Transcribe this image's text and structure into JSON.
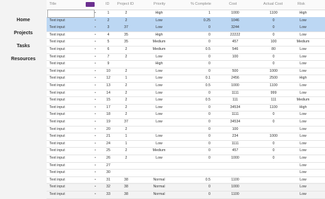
{
  "nav": [
    "Home",
    "Projects",
    "Tasks",
    "Resources"
  ],
  "columns": {
    "title": "Title",
    "id": "ID",
    "project_id": "Project ID",
    "priority": "Priority",
    "percent_complete": "% Complete",
    "cost": "Cost",
    "actual_cost": "Actual Cost",
    "risk": "Risk"
  },
  "selected_row": 0,
  "highlight_rows": [
    1,
    2
  ],
  "rows": [
    {
      "title": "Text input",
      "id": "1",
      "pid": "2",
      "pri": "High",
      "pct": "1",
      "cost": "1000",
      "act": "1100",
      "risk": "High"
    },
    {
      "title": "Text input",
      "id": "2",
      "pid": "2",
      "pri": "Low",
      "pct": "0.25",
      "cost": "1046",
      "act": "0",
      "risk": "Low"
    },
    {
      "title": "Text input",
      "id": "3",
      "pid": "37",
      "pri": "Low",
      "pct": "0",
      "cost": "3244",
      "act": "0",
      "risk": "Low"
    },
    {
      "title": "Text input",
      "id": "4",
      "pid": "35",
      "pri": "High",
      "pct": "0",
      "cost": "22222",
      "act": "0",
      "risk": "Low"
    },
    {
      "title": "Text input",
      "id": "5",
      "pid": "35",
      "pri": "Medium",
      "pct": "0",
      "cost": "457",
      "act": "100",
      "risk": "Medium"
    },
    {
      "title": "Text input",
      "id": "6",
      "pid": "2",
      "pri": "Medium",
      "pct": "0.5",
      "cost": "546",
      "act": "80",
      "risk": "Low"
    },
    {
      "title": "Text input",
      "id": "7",
      "pid": "2",
      "pri": "Low",
      "pct": "0",
      "cost": "100",
      "act": "0",
      "risk": "Low"
    },
    {
      "title": "Text input",
      "id": "9",
      "pid": "",
      "pri": "High",
      "pct": "0",
      "cost": "",
      "act": "0",
      "risk": "Low"
    },
    {
      "title": "Text input",
      "id": "10",
      "pid": "2",
      "pri": "Low",
      "pct": "0",
      "cost": "500",
      "act": "1000",
      "risk": "Low"
    },
    {
      "title": "Text input",
      "id": "12",
      "pid": "1",
      "pri": "Low",
      "pct": "0.1",
      "cost": "2456",
      "act": "2500",
      "risk": "High"
    },
    {
      "title": "Text input",
      "id": "13",
      "pid": "2",
      "pri": "Low",
      "pct": "0.5",
      "cost": "1000",
      "act": "1100",
      "risk": "Low"
    },
    {
      "title": "Text input",
      "id": "14",
      "pid": "2",
      "pri": "Low",
      "pct": "0",
      "cost": "1111",
      "act": "999",
      "risk": "Low"
    },
    {
      "title": "Text input",
      "id": "15",
      "pid": "2",
      "pri": "Low",
      "pct": "0.5",
      "cost": "111",
      "act": "111",
      "risk": "Medium"
    },
    {
      "title": "Text input",
      "id": "17",
      "pid": "2",
      "pri": "Low",
      "pct": "0",
      "cost": "34534",
      "act": "1100",
      "risk": "High"
    },
    {
      "title": "Text input",
      "id": "18",
      "pid": "2",
      "pri": "Low",
      "pct": "0",
      "cost": "1111",
      "act": "0",
      "risk": "Low"
    },
    {
      "title": "Text input",
      "id": "19",
      "pid": "37",
      "pri": "Low",
      "pct": "0",
      "cost": "34534",
      "act": "0",
      "risk": "Low"
    },
    {
      "title": "Text input",
      "id": "20",
      "pid": "2",
      "pri": "",
      "pct": "0",
      "cost": "100",
      "act": "",
      "risk": "Low"
    },
    {
      "title": "Text input",
      "id": "21",
      "pid": "1",
      "pri": "Low",
      "pct": "0",
      "cost": "234",
      "act": "1000",
      "risk": "Low"
    },
    {
      "title": "Text input",
      "id": "24",
      "pid": "1",
      "pri": "Low",
      "pct": "0",
      "cost": "1111",
      "act": "0",
      "risk": "Low"
    },
    {
      "title": "Text input",
      "id": "25",
      "pid": "2",
      "pri": "Medium",
      "pct": "0",
      "cost": "457",
      "act": "0",
      "risk": "Low"
    },
    {
      "title": "Text input",
      "id": "26",
      "pid": "2",
      "pri": "Low",
      "pct": "0",
      "cost": "1000",
      "act": "0",
      "risk": "Low"
    },
    {
      "title": "Text input",
      "id": "27",
      "pid": "",
      "pri": "",
      "pct": "",
      "cost": "",
      "act": "",
      "risk": "Low"
    },
    {
      "title": "Text input",
      "id": "30",
      "pid": "",
      "pri": "",
      "pct": "",
      "cost": "",
      "act": "",
      "risk": "Low"
    },
    {
      "title": "Text input",
      "id": "31",
      "pid": "38",
      "pri": "Normal",
      "pct": "0.5",
      "cost": "1100",
      "act": "",
      "risk": "Low"
    },
    {
      "title": "Text input",
      "id": "32",
      "pid": "38",
      "pri": "Normal",
      "pct": "0",
      "cost": "1000",
      "act": "",
      "risk": "Low"
    },
    {
      "title": "Text input",
      "id": "33",
      "pid": "38",
      "pri": "Normal",
      "pct": "0",
      "cost": "1100",
      "act": "",
      "risk": "Low"
    }
  ]
}
